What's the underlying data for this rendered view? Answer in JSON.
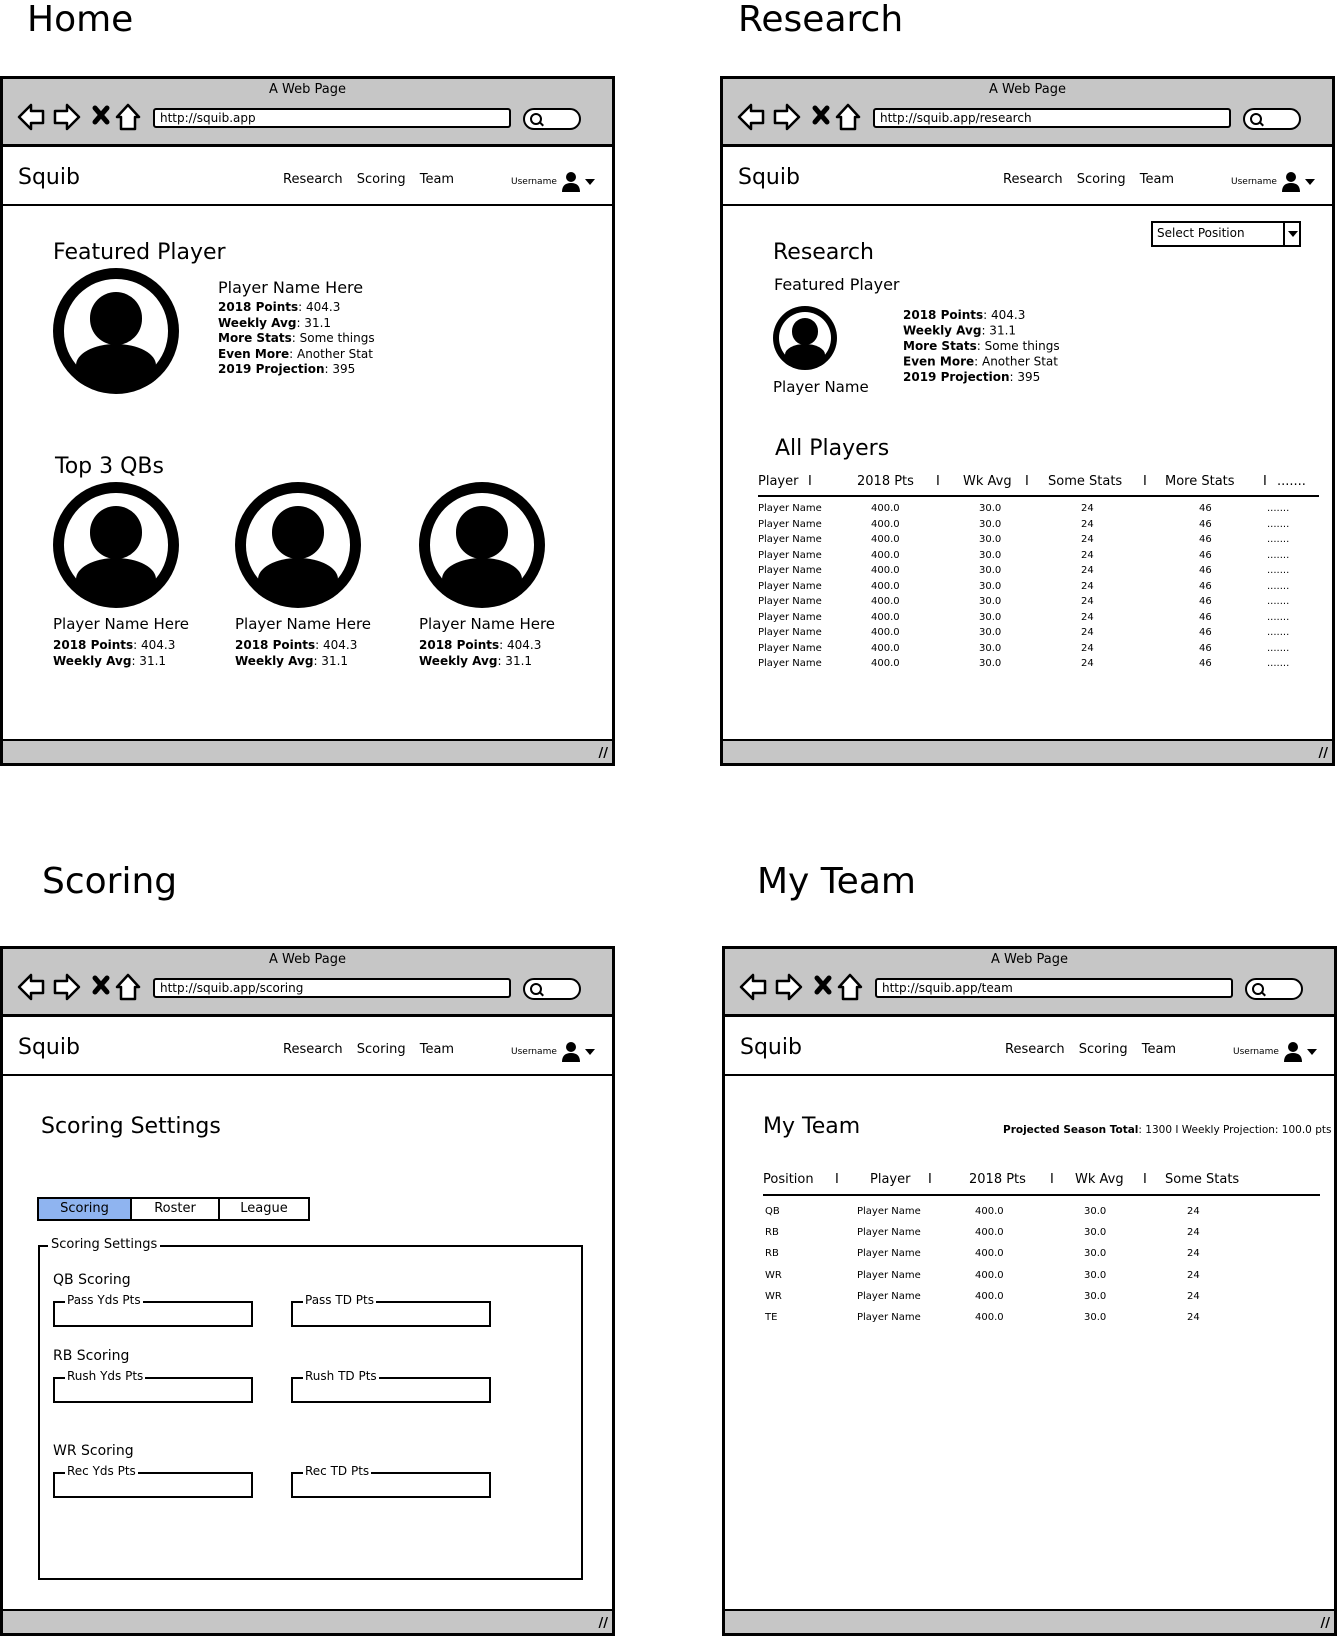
{
  "sections": {
    "home": "Home",
    "research": "Research",
    "scoring": "Scoring",
    "my_team": "My Team"
  },
  "browser": {
    "window_title": "A Web Page",
    "urls": {
      "home": "http://squib.app",
      "research": "http://squib.app/research",
      "scoring": "http://squib.app/scoring",
      "team": "http://squib.app/team"
    }
  },
  "appbar": {
    "brand": "Squib",
    "nav": [
      "Research",
      "Scoring",
      "Team"
    ],
    "username": "Username",
    "icons": [
      "user-icon",
      "caret-down-icon"
    ]
  },
  "home": {
    "featured_heading": "Featured Player",
    "featured": {
      "name": "Player Name Here",
      "stats": [
        {
          "label": "2018 Points",
          "value": ": 404.3"
        },
        {
          "label": "Weekly Avg",
          "value": ": 31.1"
        },
        {
          "label": "More Stats",
          "value": ": Some things"
        },
        {
          "label": "Even More",
          "value": ": Another Stat"
        },
        {
          "label": "2019 Projection",
          "value": ": 395"
        }
      ]
    },
    "top_heading": "Top 3 QBs",
    "top_players": [
      {
        "name": "Player Name Here",
        "pts_label": "2018 Points",
        "pts": ": 404.3",
        "avg_label": "Weekly Avg",
        "avg": ": 31.1"
      },
      {
        "name": "Player Name Here",
        "pts_label": "2018 Points",
        "pts": ": 404.3",
        "avg_label": "Weekly Avg",
        "avg": ": 31.1"
      },
      {
        "name": "Player Name Here",
        "pts_label": "2018 Points",
        "pts": ": 404.3",
        "avg_label": "Weekly Avg",
        "avg": ": 31.1"
      }
    ]
  },
  "research": {
    "select_position": "Select Position",
    "heading": "Research",
    "featured_heading": "Featured Player",
    "featured_name": "Player Name",
    "stats": [
      {
        "label": "2018 Points",
        "value": ": 404.3"
      },
      {
        "label": "Weekly Avg",
        "value": ": 31.1"
      },
      {
        "label": "More Stats",
        "value": ": Some things"
      },
      {
        "label": "Even More",
        "value": ": Another Stat"
      },
      {
        "label": "2019 Projection",
        "value": ": 395"
      }
    ],
    "all_heading": "All Players",
    "columns": [
      "Player",
      "I",
      "2018 Pts",
      "I",
      "Wk Avg",
      "I",
      "Some Stats",
      "I",
      "More Stats",
      "I",
      "......."
    ],
    "rows": [
      [
        "Player Name",
        "400.0",
        "30.0",
        "24",
        "46",
        "......."
      ],
      [
        "Player Name",
        "400.0",
        "30.0",
        "24",
        "46",
        "......."
      ],
      [
        "Player Name",
        "400.0",
        "30.0",
        "24",
        "46",
        "......."
      ],
      [
        "Player Name",
        "400.0",
        "30.0",
        "24",
        "46",
        "......."
      ],
      [
        "Player Name",
        "400.0",
        "30.0",
        "24",
        "46",
        "......."
      ],
      [
        "Player Name",
        "400.0",
        "30.0",
        "24",
        "46",
        "......."
      ],
      [
        "Player Name",
        "400.0",
        "30.0",
        "24",
        "46",
        "......."
      ],
      [
        "Player Name",
        "400.0",
        "30.0",
        "24",
        "46",
        "......."
      ],
      [
        "Player Name",
        "400.0",
        "30.0",
        "24",
        "46",
        "......."
      ],
      [
        "Player Name",
        "400.0",
        "30.0",
        "24",
        "46",
        "......."
      ],
      [
        "Player Name",
        "400.0",
        "30.0",
        "24",
        "46",
        "......."
      ]
    ]
  },
  "scoring": {
    "heading": "Scoring Settings",
    "tabs": [
      "Scoring",
      "Roster",
      "League"
    ],
    "active_tab": "Scoring",
    "group_legend": "Scoring Settings",
    "groups": [
      {
        "title": "QB Scoring",
        "fields": [
          "Pass Yds Pts",
          "Pass TD Pts"
        ]
      },
      {
        "title": "RB Scoring",
        "fields": [
          "Rush Yds Pts",
          "Rush TD Pts"
        ]
      },
      {
        "title": "WR Scoring",
        "fields": [
          "Rec Yds Pts",
          "Rec TD Pts"
        ]
      }
    ],
    "active_color": "#8fb4f0"
  },
  "team": {
    "heading": "My Team",
    "summary_label": "Projected Season Total",
    "summary_value": ": 1300  I  Weekly Projection: 100.0 pts",
    "columns": [
      "Position",
      "I",
      "Player",
      "I",
      "2018 Pts",
      "I",
      "Wk Avg",
      "I",
      "Some Stats"
    ],
    "rows": [
      [
        "QB",
        "Player Name",
        "400.0",
        "30.0",
        "24"
      ],
      [
        "RB",
        "Player Name",
        "400.0",
        "30.0",
        "24"
      ],
      [
        "RB",
        "Player Name",
        "400.0",
        "30.0",
        "24"
      ],
      [
        "WR",
        "Player Name",
        "400.0",
        "30.0",
        "24"
      ],
      [
        "WR",
        "Player Name",
        "400.0",
        "30.0",
        "24"
      ],
      [
        "TE",
        "Player Name",
        "400.0",
        "30.0",
        "24"
      ]
    ]
  },
  "colors": {
    "chrome": "#c6c6c6",
    "active_tab": "#8fb4f0"
  }
}
